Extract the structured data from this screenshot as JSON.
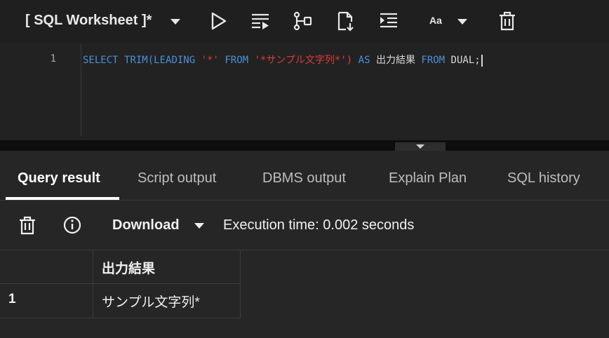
{
  "toolbar": {
    "title": "[ SQL Worksheet ]*",
    "font_label": "Aa",
    "icons": [
      "run-icon",
      "run-script-icon",
      "explain-plan-icon",
      "autotrace-icon",
      "format-icon",
      "font-size-icon",
      "clear-icon"
    ]
  },
  "editor": {
    "line_number": "1",
    "tokens": [
      {
        "text": "SELECT",
        "type": "keyword"
      },
      {
        "text": " ",
        "type": "plain"
      },
      {
        "text": "TRIM(LEADING",
        "type": "keyword"
      },
      {
        "text": " ",
        "type": "plain"
      },
      {
        "text": "'*'",
        "type": "string"
      },
      {
        "text": " ",
        "type": "plain"
      },
      {
        "text": "FROM",
        "type": "keyword"
      },
      {
        "text": " ",
        "type": "plain"
      },
      {
        "text": "'*サンプル文字列*')",
        "type": "string"
      },
      {
        "text": " ",
        "type": "plain"
      },
      {
        "text": "AS",
        "type": "keyword"
      },
      {
        "text": " 出力結果 ",
        "type": "plain"
      },
      {
        "text": "FROM",
        "type": "keyword"
      },
      {
        "text": " DUAL;",
        "type": "plain"
      }
    ]
  },
  "tabs": [
    {
      "label": "Query result",
      "active": true
    },
    {
      "label": "Script output",
      "active": false
    },
    {
      "label": "DBMS output",
      "active": false
    },
    {
      "label": "Explain Plan",
      "active": false
    },
    {
      "label": "SQL history",
      "active": false
    }
  ],
  "result_toolbar": {
    "download_label": "Download",
    "execution_time": "Execution time: 0.002 seconds"
  },
  "result_grid": {
    "columns": [
      "出力結果"
    ],
    "rows": [
      {
        "row_number": "1",
        "values": [
          "サンプル文字列*"
        ]
      }
    ]
  },
  "colors": {
    "keyword": "#4a90d9",
    "string": "#e03a3a",
    "background": "#1e1e1e"
  }
}
